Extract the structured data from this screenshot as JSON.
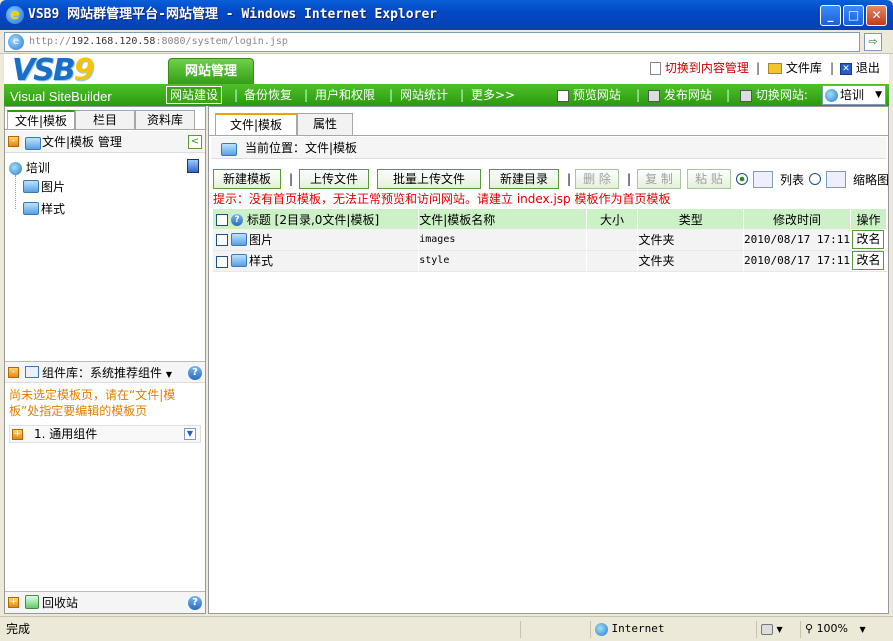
{
  "window": {
    "title": "VSB9 网站群管理平台-网站管理 - Windows Internet Explorer"
  },
  "address": {
    "url_prefix": "http://",
    "url_host": "192.168.120.58",
    "url_rest": ":8080/system/login.jsp"
  },
  "logo": {
    "main": "VSB",
    "nine": "9",
    "subtitle": "Visual SiteBuilder"
  },
  "header": {
    "main_tab": "网站管理",
    "switch_content": "切换到内容管理",
    "file_library": "文件库",
    "logout": "退出"
  },
  "nav": {
    "items": [
      "网站建设",
      "备份恢复",
      "用户和权限",
      "网站统计",
      "更多>>"
    ],
    "preview": "预览网站",
    "publish": "发布网站",
    "switch_site": "切换网站:",
    "site_selected": "培训"
  },
  "left": {
    "tabs": [
      "文件|模板",
      "栏目",
      "资料库"
    ],
    "section_title": "文件|模板 管理",
    "tree_root": "培训",
    "tree_children": [
      "图片",
      "样式"
    ],
    "component_title": "组件库：系统推荐组件",
    "component_hint": "尚未选定模板页，请在“文件|模板”处指定要编辑的模板页",
    "component_item": "1. 通用组件",
    "recycle": "回收站"
  },
  "right": {
    "tabs": [
      "文件|模板",
      "属性"
    ],
    "location_label": "当前位置：文件|模板",
    "toolbar": {
      "new_template": "新建模板",
      "upload_file": "上传文件",
      "batch_upload": "批量上传文件",
      "new_dir": "新建目录",
      "delete": "删 除",
      "copy": "复 制",
      "paste": "粘 贴",
      "view_list": "列表",
      "view_thumb": "缩略图"
    },
    "tip": "提示：没有首页模板，无法正常预览和访问网站。请建立 index.jsp 模板作为首页模板",
    "columns": [
      "标题 [2目录,0文件|模板]",
      "文件|模板名称",
      "大小",
      "类型",
      "修改时间",
      "操作"
    ],
    "rows": [
      {
        "title": "图片",
        "name": "images",
        "size": "",
        "type": "文件夹",
        "modified": "2010/08/17 17:11",
        "action": "改名"
      },
      {
        "title": "样式",
        "name": "style",
        "size": "",
        "type": "文件夹",
        "modified": "2010/08/17 17:11",
        "action": "改名"
      }
    ]
  },
  "status": {
    "left": "完成",
    "zone": "Internet",
    "zoom": "100%"
  }
}
